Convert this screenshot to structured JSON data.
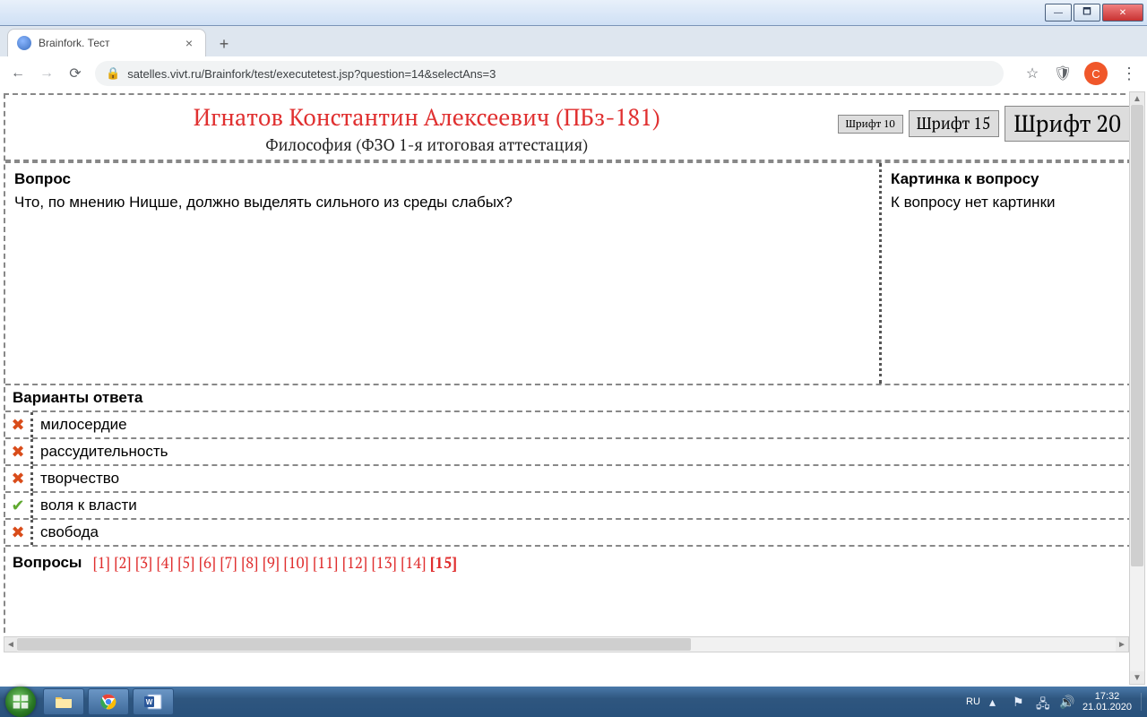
{
  "window": {
    "close": "✕",
    "max": "🗖",
    "min": "—"
  },
  "browser": {
    "tab_title": "Brainfork. Тест",
    "url": "satelles.vivt.ru/Brainfork/test/executetest.jsp?question=14&selectAns=3",
    "avatar_letter": "C"
  },
  "header": {
    "student": "Игнатов Константин Алексеевич (ПБз-181)",
    "subject": "Философия (ФЗО 1-я итоговая аттестация)",
    "font_buttons": {
      "f10": "Шрифт 10",
      "f15": "Шрифт 15",
      "f20": "Шрифт 20"
    }
  },
  "labels": {
    "question": "Вопрос",
    "picture": "Картинка к вопросу",
    "no_picture": "К вопросу нет картинки",
    "answers": "Варианты ответа",
    "questions_nav": "Вопросы"
  },
  "question_text": "Что, по мнению Ницше, должно выделять сильного из среды слабых?",
  "answers": [
    {
      "mark": "wrong",
      "text": "милосердие"
    },
    {
      "mark": "wrong",
      "text": "рассудительность"
    },
    {
      "mark": "wrong",
      "text": "творчество"
    },
    {
      "mark": "correct",
      "text": "воля к власти"
    },
    {
      "mark": "wrong",
      "text": "свобода"
    }
  ],
  "nav_links": [
    "[1]",
    "[2]",
    "[3]",
    "[4]",
    "[5]",
    "[6]",
    "[7]",
    "[8]",
    "[9]",
    "[10]",
    "[11]",
    "[12]",
    "[13]",
    "[14]",
    "[15]"
  ],
  "nav_current": "[15]",
  "system": {
    "lang": "RU",
    "time": "17:32",
    "date": "21.01.2020"
  }
}
